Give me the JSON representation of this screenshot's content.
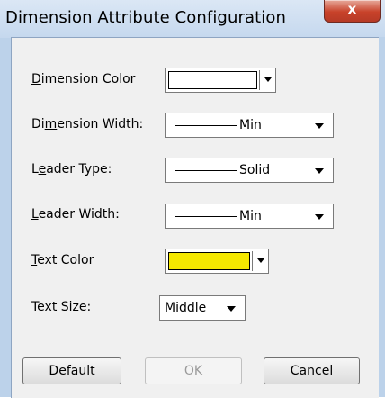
{
  "window": {
    "title": "Dimension Attribute Configuration",
    "close_label": "x"
  },
  "fields": {
    "dimension_color": {
      "label_pre": "",
      "mnemonic": "D",
      "label_post": "imension Color",
      "color": "#ffffff"
    },
    "dimension_width": {
      "label_pre": "Di",
      "mnemonic": "m",
      "label_post": "ension Width:",
      "value": "Min"
    },
    "leader_type": {
      "label_pre": "L",
      "mnemonic": "e",
      "label_post": "ader Type:",
      "value": "Solid"
    },
    "leader_width": {
      "label_pre": "",
      "mnemonic": "L",
      "label_post": "eader Width:",
      "value": "Min"
    },
    "text_color": {
      "label_pre": "",
      "mnemonic": "T",
      "label_post": "ext Color",
      "color": "#f5e800"
    },
    "text_size": {
      "label_pre": "Te",
      "mnemonic": "x",
      "label_post": "t Size:",
      "value": "Middle"
    }
  },
  "buttons": {
    "default_label": "Default",
    "ok_label": "OK",
    "cancel_label": "Cancel"
  }
}
